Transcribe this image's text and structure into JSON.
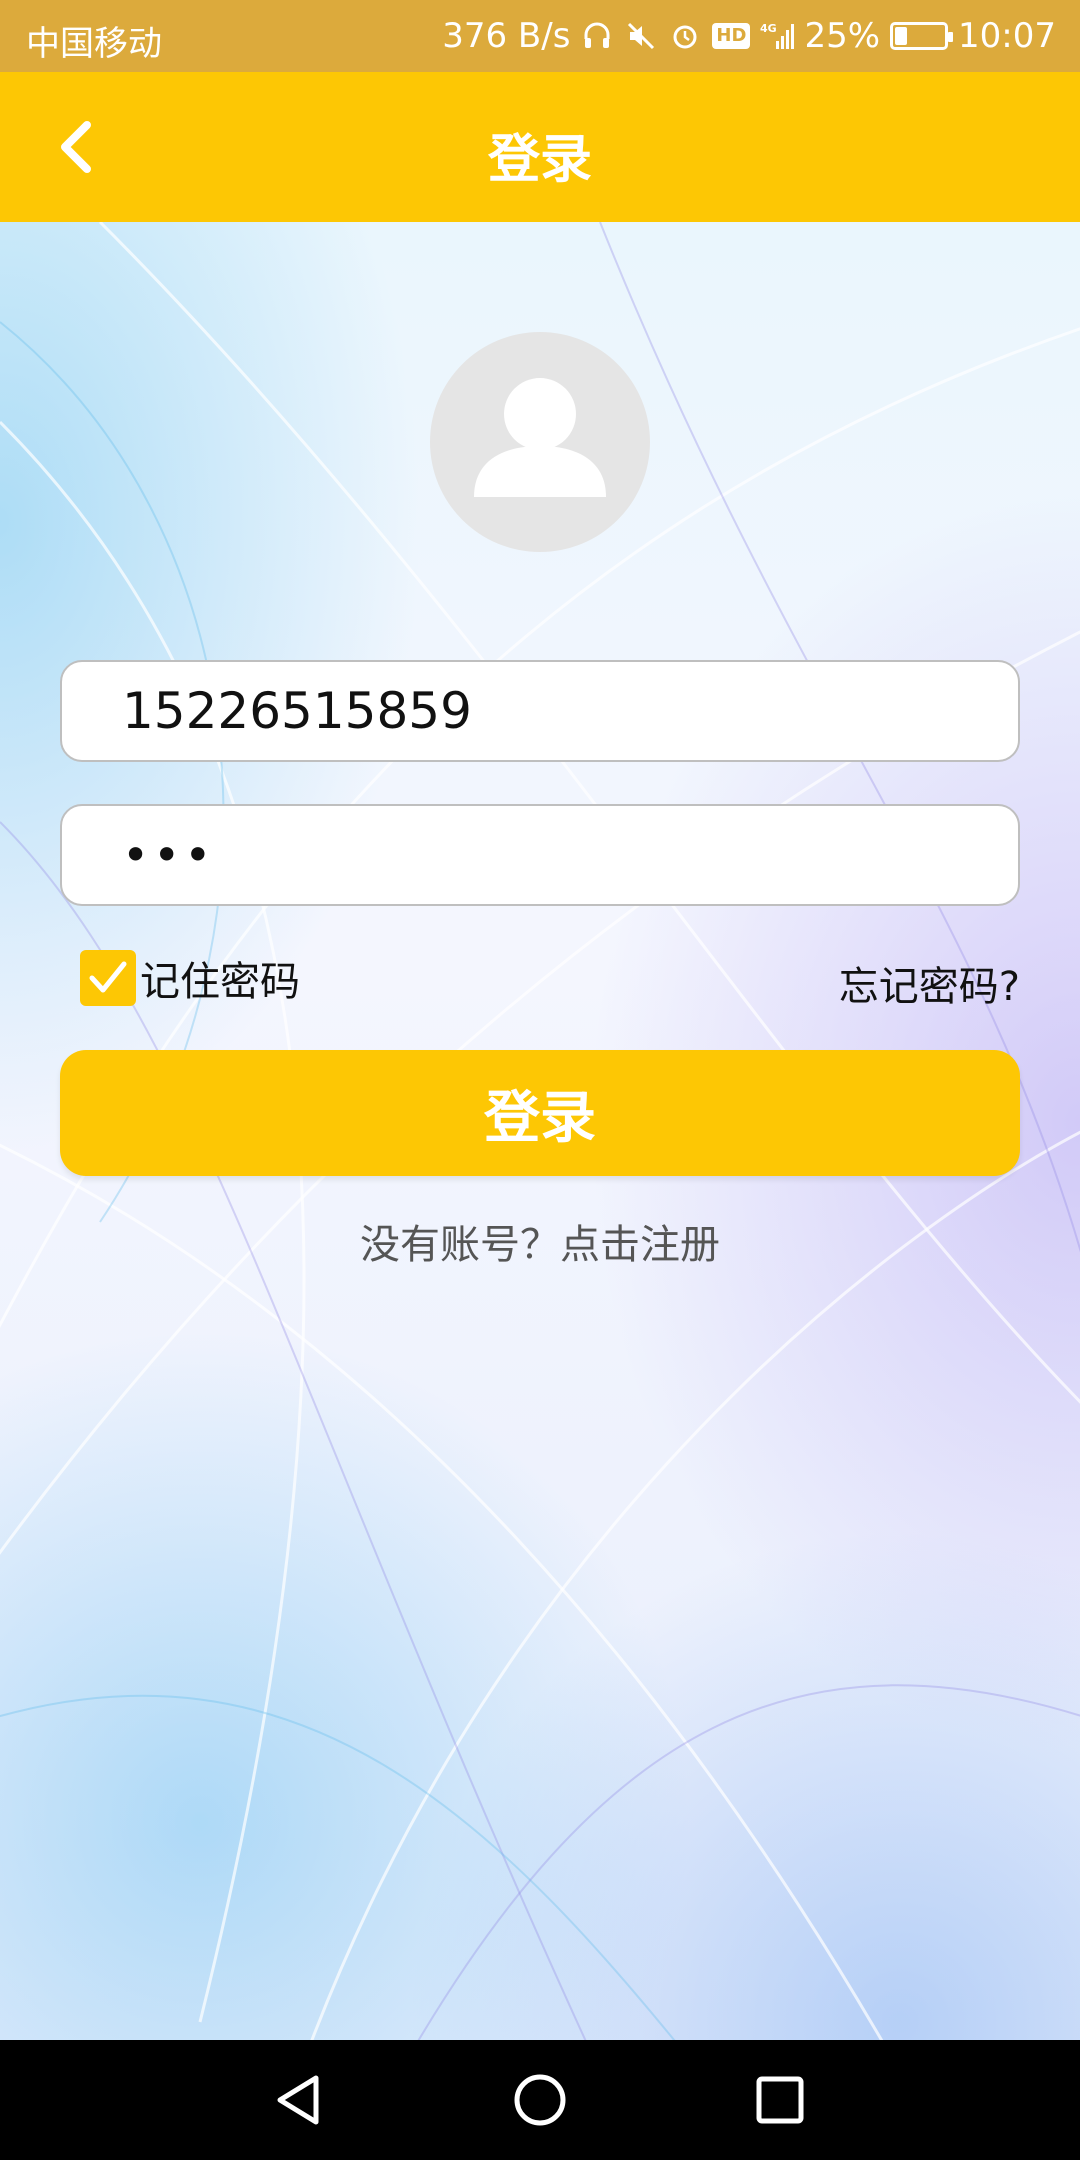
{
  "status_bar": {
    "carrier": "中国移动",
    "net_speed": "376 B/s",
    "hd_label": "HD",
    "network": "4G",
    "battery": "25%",
    "battery_level": 0.25,
    "time": "10:07"
  },
  "header": {
    "title": "登录",
    "back_icon": "chevron-left-icon",
    "background_color": "#fdc704"
  },
  "login_form": {
    "avatar_icon": "user-avatar-icon",
    "username_value": "15226515859",
    "password_value": "•••",
    "remember_password_label": "记住密码",
    "remember_password_checked": true,
    "forgot_password_label": "忘记密码?",
    "submit_label": "登录",
    "register_prompt": "没有账号？点击注册"
  },
  "nav_bar": {
    "back_icon": "triangle-back-icon",
    "home_icon": "circle-home-icon",
    "recent_icon": "square-recents-icon"
  },
  "colors": {
    "accent": "#fdc704",
    "status_bar": "#dcaa3c"
  }
}
